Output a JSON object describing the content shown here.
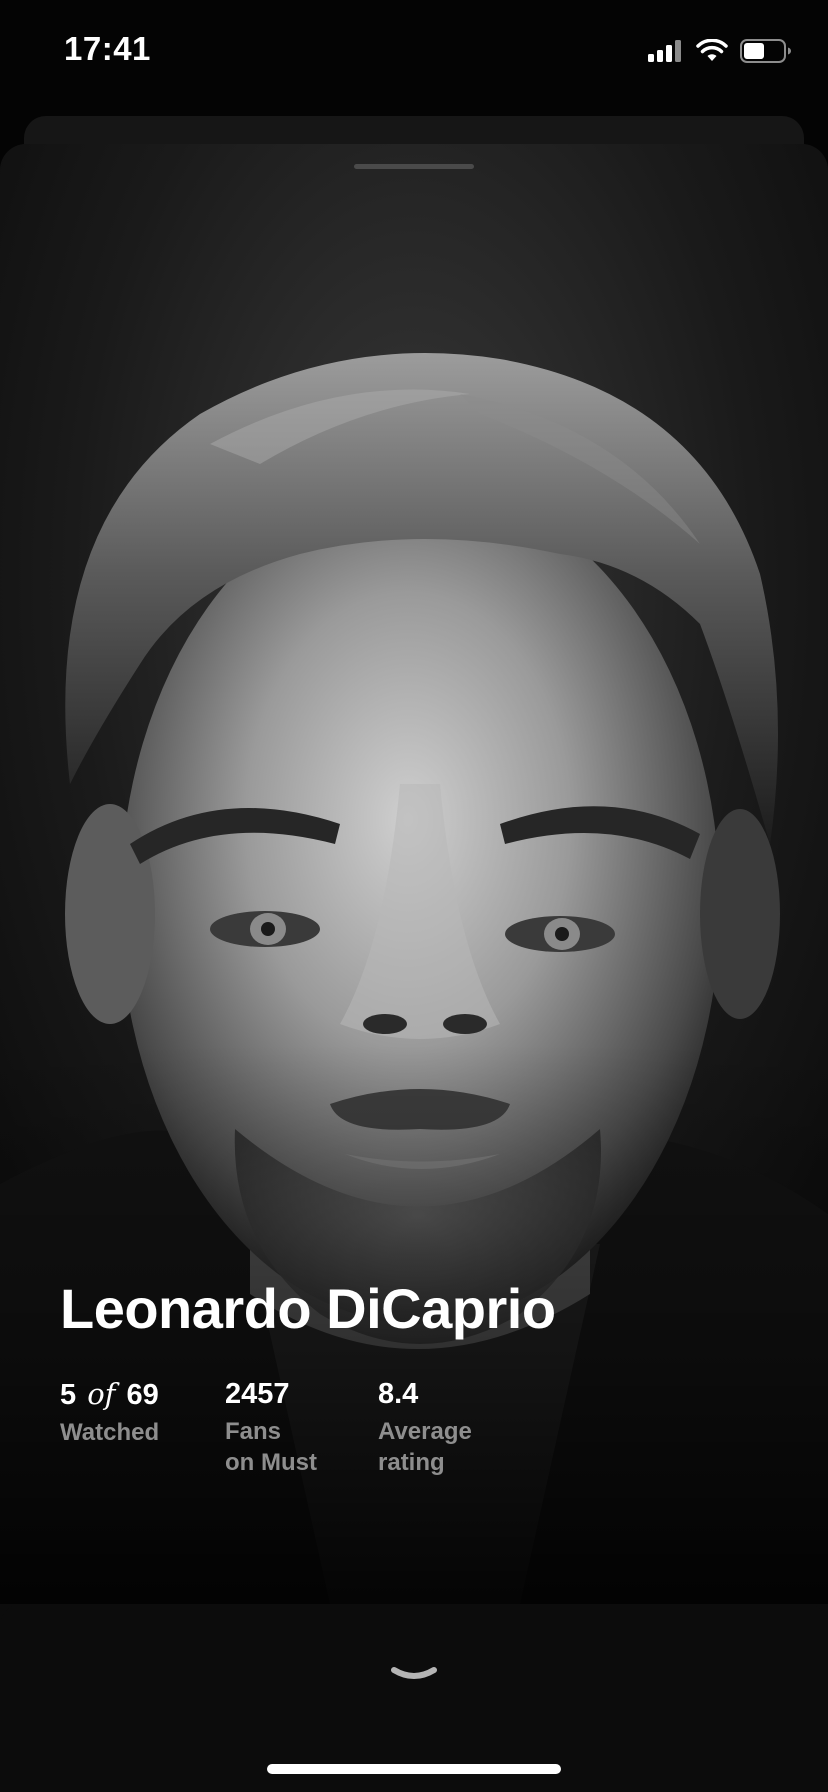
{
  "status_bar": {
    "time": "17:41",
    "icons": [
      "cellular-signal-icon",
      "wifi-icon",
      "battery-icon"
    ]
  },
  "sheet": {
    "portrait": {
      "kind": "black-and-white actor portrait"
    },
    "person": {
      "name": "Leonardo DiCaprio"
    },
    "stats": {
      "watched": {
        "count": "5",
        "of": "of",
        "total": "69",
        "label": "Watched"
      },
      "fans": {
        "value": "2457",
        "label_line1": "Fans",
        "label_line2": "on Must"
      },
      "rating": {
        "value": "8.4",
        "label_line1": "Average",
        "label_line2": "rating"
      }
    }
  },
  "bottom_panel": {
    "icon": "chevron-down-icon"
  },
  "colors": {
    "background": "#040404",
    "text_primary": "#ffffff",
    "text_secondary": "#8e8e8e"
  }
}
